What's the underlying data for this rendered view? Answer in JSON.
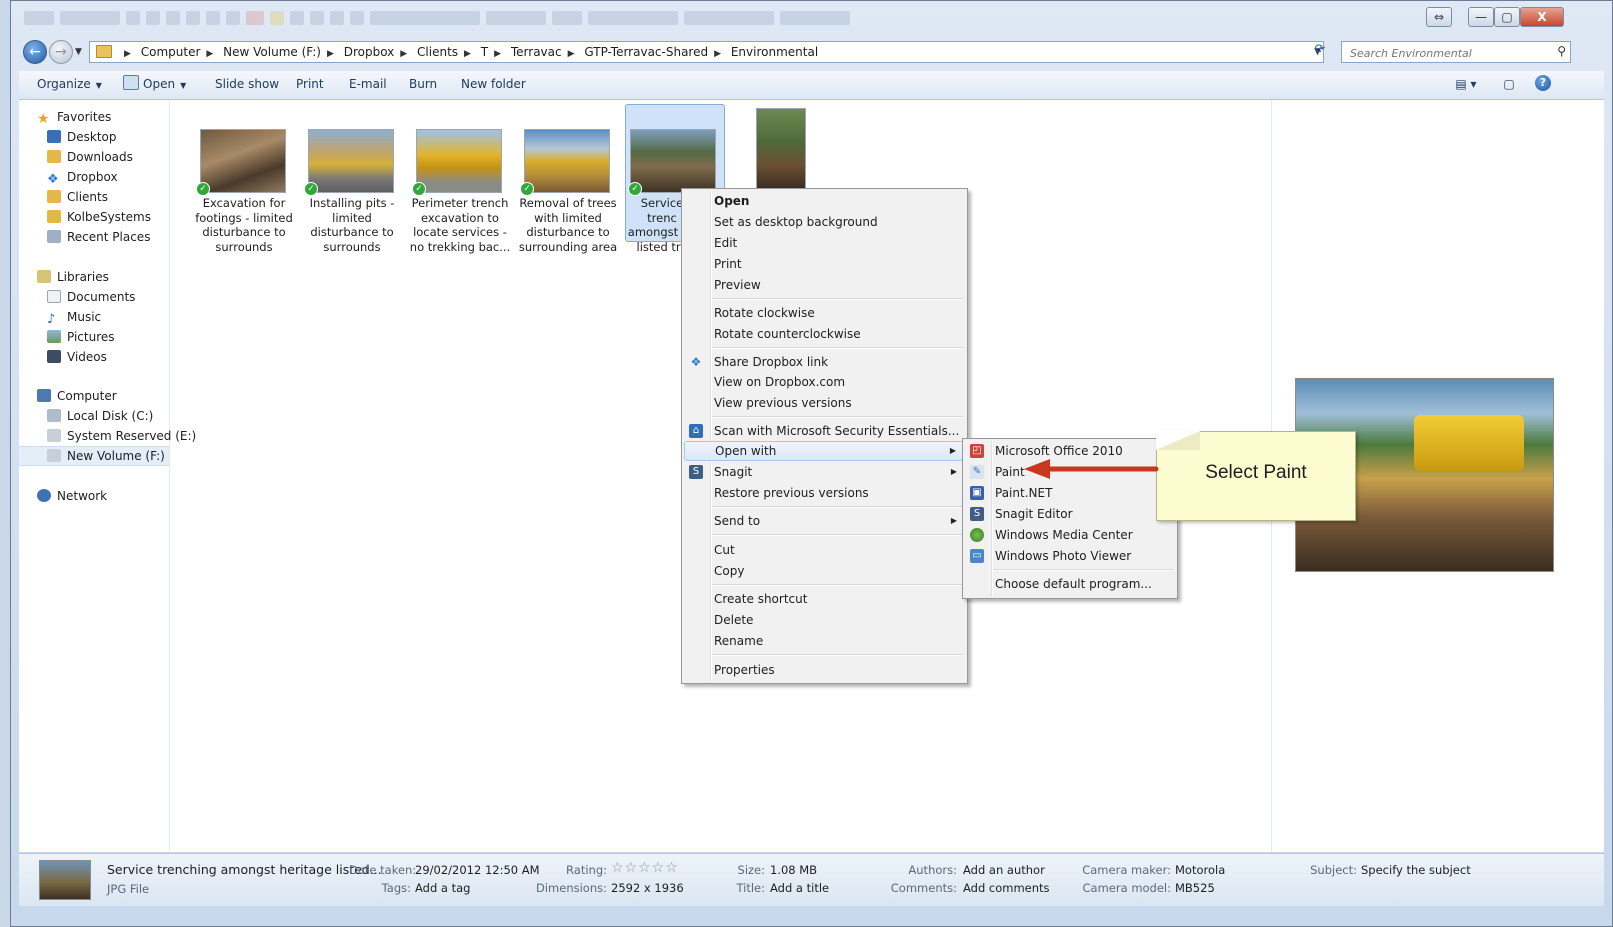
{
  "window": {
    "controls": [
      "⇔",
      "—",
      "▢",
      "X"
    ]
  },
  "address": {
    "crumbs": [
      "Computer",
      "New Volume (F:)",
      "Dropbox",
      "Clients",
      "T",
      "Terravac",
      "GTP-Terravac-Shared",
      "Environmental"
    ],
    "search_placeholder": "Search Environmental"
  },
  "toolbar": {
    "organize": "Organize",
    "open": "Open",
    "slideshow": "Slide show",
    "print": "Print",
    "email": "E-mail",
    "burn": "Burn",
    "new_folder": "New folder",
    "help": "?"
  },
  "nav": {
    "favorites": "Favorites",
    "desktop": "Desktop",
    "downloads": "Downloads",
    "dropbox": "Dropbox",
    "clients": "Clients",
    "kolbe": "KolbeSystems",
    "recent": "Recent Places",
    "libraries": "Libraries",
    "documents": "Documents",
    "music": "Music",
    "pictures": "Pictures",
    "videos": "Videos",
    "computer": "Computer",
    "localdisk": "Local Disk (C:)",
    "sysreserved": "System Reserved (E:)",
    "newvolume": "New Volume (F:)",
    "network": "Network"
  },
  "files": [
    {
      "line1": "Excavation for",
      "line2": "footings - limited",
      "line3": "disturbance to",
      "line4": "surrounds"
    },
    {
      "line1": "Installing pits -",
      "line2": "limited",
      "line3": "disturbance to",
      "line4": "surrounds"
    },
    {
      "line1": "Perimeter trench",
      "line2": "excavation to",
      "line3": "locate services -",
      "line4": "no trekking bac..."
    },
    {
      "line1": "Removal of trees",
      "line2": "with limited",
      "line3": "disturbance to",
      "line4": "surrounding area"
    },
    {
      "line1": "Service trenc",
      "line2": "amongst he",
      "line3": "listed tre",
      "line4": ""
    }
  ],
  "context_menu": {
    "open": "Open",
    "desktop_bg": "Set as desktop background",
    "edit": "Edit",
    "print": "Print",
    "preview": "Preview",
    "rot_cw": "Rotate clockwise",
    "rot_ccw": "Rotate counterclockwise",
    "share_dropbox": "Share Dropbox link",
    "view_dropbox": "View on Dropbox.com",
    "view_prev": "View previous versions",
    "scan": "Scan with Microsoft Security Essentials...",
    "open_with": "Open with",
    "snagit": "Snagit",
    "restore": "Restore previous versions",
    "send_to": "Send to",
    "cut": "Cut",
    "copy": "Copy",
    "create_shortcut": "Create shortcut",
    "delete": "Delete",
    "rename": "Rename",
    "properties": "Properties"
  },
  "open_with_menu": {
    "office": "Microsoft Office 2010",
    "paint": "Paint",
    "paintnet": "Paint.NET",
    "snagit_editor": "Snagit Editor",
    "wmc": "Windows Media Center",
    "wpv": "Windows Photo Viewer",
    "choose": "Choose default program..."
  },
  "callout": {
    "text": "Select Paint",
    "arrow_color": "#c8371f"
  },
  "details": {
    "name": "Service trenching amongst heritage listed...",
    "type": "JPG File",
    "date_taken_label": "Date taken:",
    "date_taken": "29/02/2012 12:50 AM",
    "tags_label": "Tags:",
    "tags": "Add a tag",
    "rating_label": "Rating:",
    "rating_stars": "☆☆☆☆☆",
    "dimensions_label": "Dimensions:",
    "dimensions": "2592 x 1936",
    "size_label": "Size:",
    "size": "1.08 MB",
    "title_label": "Title:",
    "title": "Add a title",
    "authors_label": "Authors:",
    "authors": "Add an author",
    "comments_label": "Comments:",
    "comments": "Add comments",
    "camera_maker_label": "Camera maker:",
    "camera_maker": "Motorola",
    "camera_model_label": "Camera model:",
    "camera_model": "MB525",
    "subject_label": "Subject:",
    "subject": "Specify the subject"
  }
}
